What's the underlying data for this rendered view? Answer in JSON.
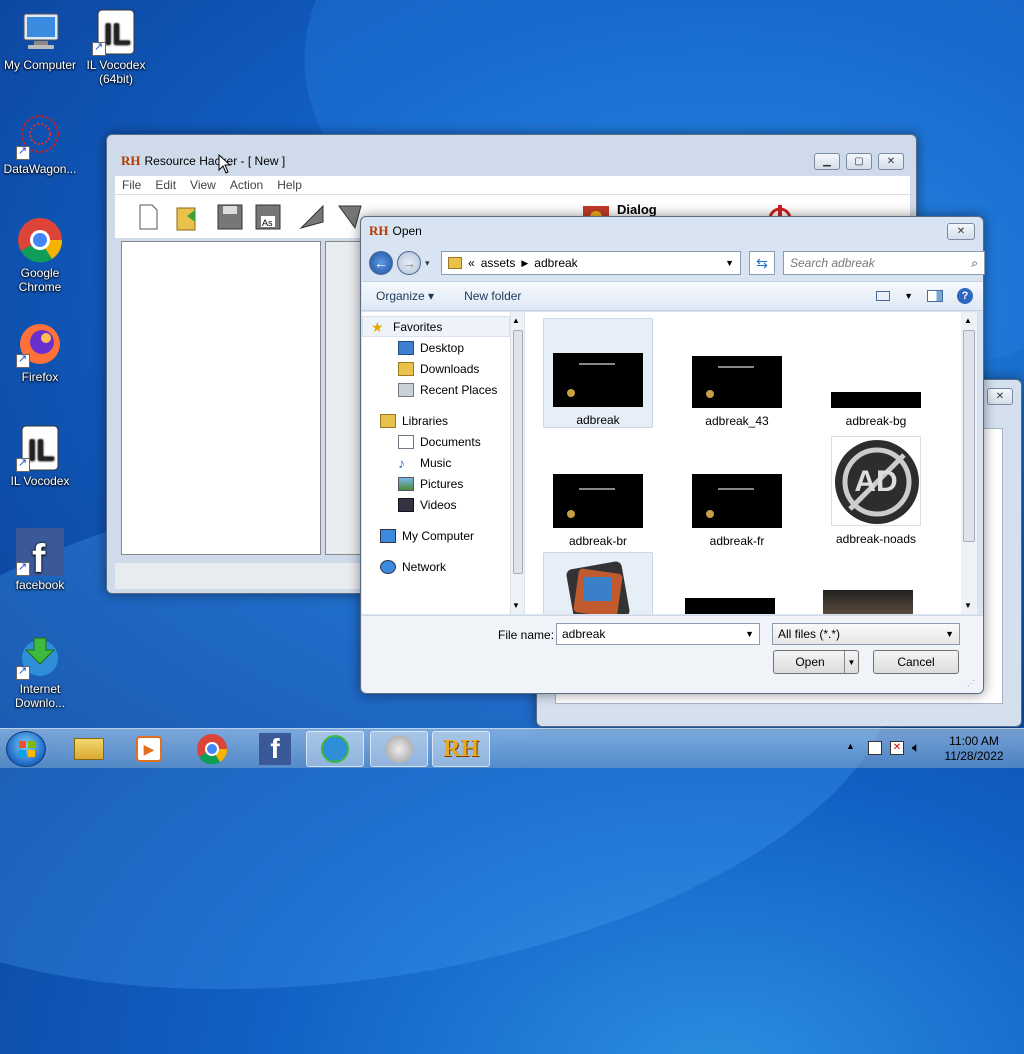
{
  "desktop": {
    "icons": [
      {
        "label": "My Computer"
      },
      {
        "label": "IL Vocodex (64bit)"
      },
      {
        "label": "DataWagon..."
      },
      {
        "label": "Google Chrome"
      },
      {
        "label": "Firefox"
      },
      {
        "label": "IL Vocodex"
      },
      {
        "label": "facebook"
      },
      {
        "label": "Internet Downlo..."
      }
    ]
  },
  "resource_hacker": {
    "logo": "RH",
    "title": "Resource Hacker - [ New ]",
    "menu": [
      "File",
      "Edit",
      "View",
      "Action",
      "Help"
    ],
    "toolbar_dialog_label": "Dialog",
    "caption": {
      "min": "▁",
      "max": "▢",
      "close": "✕"
    }
  },
  "open_dialog": {
    "logo": "RH",
    "title": "Open",
    "close": "✕",
    "breadcrumb": {
      "root": "«",
      "parts": [
        "assets",
        "adbreak"
      ]
    },
    "search_placeholder": "Search adbreak",
    "commands": {
      "organize": "Organize ▾",
      "new_folder": "New folder"
    },
    "nav": {
      "favorites": "Favorites",
      "desktop": "Desktop",
      "downloads": "Downloads",
      "recent": "Recent Places",
      "libraries": "Libraries",
      "documents": "Documents",
      "music": "Music",
      "pictures": "Pictures",
      "videos": "Videos",
      "computer": "My Computer",
      "network": "Network"
    },
    "files": [
      {
        "name": "adbreak"
      },
      {
        "name": "adbreak_43"
      },
      {
        "name": "adbreak-bg"
      },
      {
        "name": "adbreak-br"
      },
      {
        "name": "adbreak-fr"
      },
      {
        "name": "adbreak-noads"
      }
    ],
    "adbreak_noads_text": "AD",
    "file_name_label": "File name:",
    "file_name_value": "adbreak",
    "file_type": "All files (*.*)",
    "open_button": "Open",
    "cancel_button": "Cancel"
  },
  "taskbar": {
    "time": "11:00 AM",
    "date": "11/28/2022",
    "rh_label": "RH"
  },
  "colors": {
    "desktop_blue": "#1260c4",
    "rh_logo": "#b23c00",
    "link_blue": "#1e395b"
  }
}
